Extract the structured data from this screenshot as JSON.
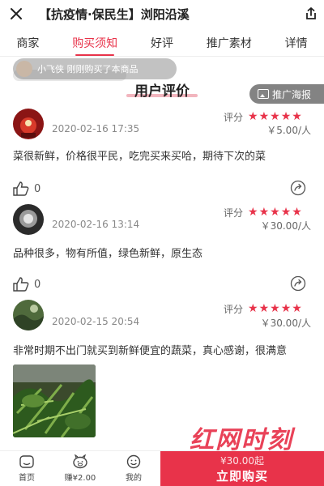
{
  "header": {
    "title": "【抗疫情·保民生】浏阳沿溪",
    "close_icon": "close-icon",
    "share_icon": "share-icon"
  },
  "tabs": [
    {
      "label": "商家",
      "active": false
    },
    {
      "label": "购买须知",
      "active": true
    },
    {
      "label": "好评",
      "active": false
    },
    {
      "label": "推广素材",
      "active": false
    },
    {
      "label": "详情",
      "active": false
    }
  ],
  "notice": {
    "text": "小飞侠 刚刚购买了本商品"
  },
  "section": {
    "title": "用户评价"
  },
  "poster_button": {
    "label": "推广海报"
  },
  "reviews": [
    {
      "username": "",
      "time": "2020-02-16 17:35",
      "rating_label": "评分",
      "stars": 5,
      "price": "￥5.00/人",
      "content": "菜很新鲜，价格很平民，吃完买来买哈，期待下次的菜",
      "likes": "0"
    },
    {
      "username": "",
      "time": "2020-02-16 13:14",
      "rating_label": "评分",
      "stars": 5,
      "price": "￥30.00/人",
      "content": "品种很多，物有所值，绿色新鲜，原生态",
      "likes": "0"
    },
    {
      "username": "",
      "time": "2020-02-15 20:54",
      "rating_label": "评分",
      "stars": 5,
      "price": "￥30.00/人",
      "content": "非常时期不出门就买到新鲜便宜的蔬菜，真心感谢，很满意",
      "likes": ""
    }
  ],
  "bottom_nav": {
    "home": "首页",
    "earn": "赚¥2.00",
    "mine": "我的",
    "buy_price": "¥30.00起",
    "buy_label": "立即购买"
  },
  "watermark": "红网时刻",
  "colors": {
    "accent": "#e8334a"
  }
}
